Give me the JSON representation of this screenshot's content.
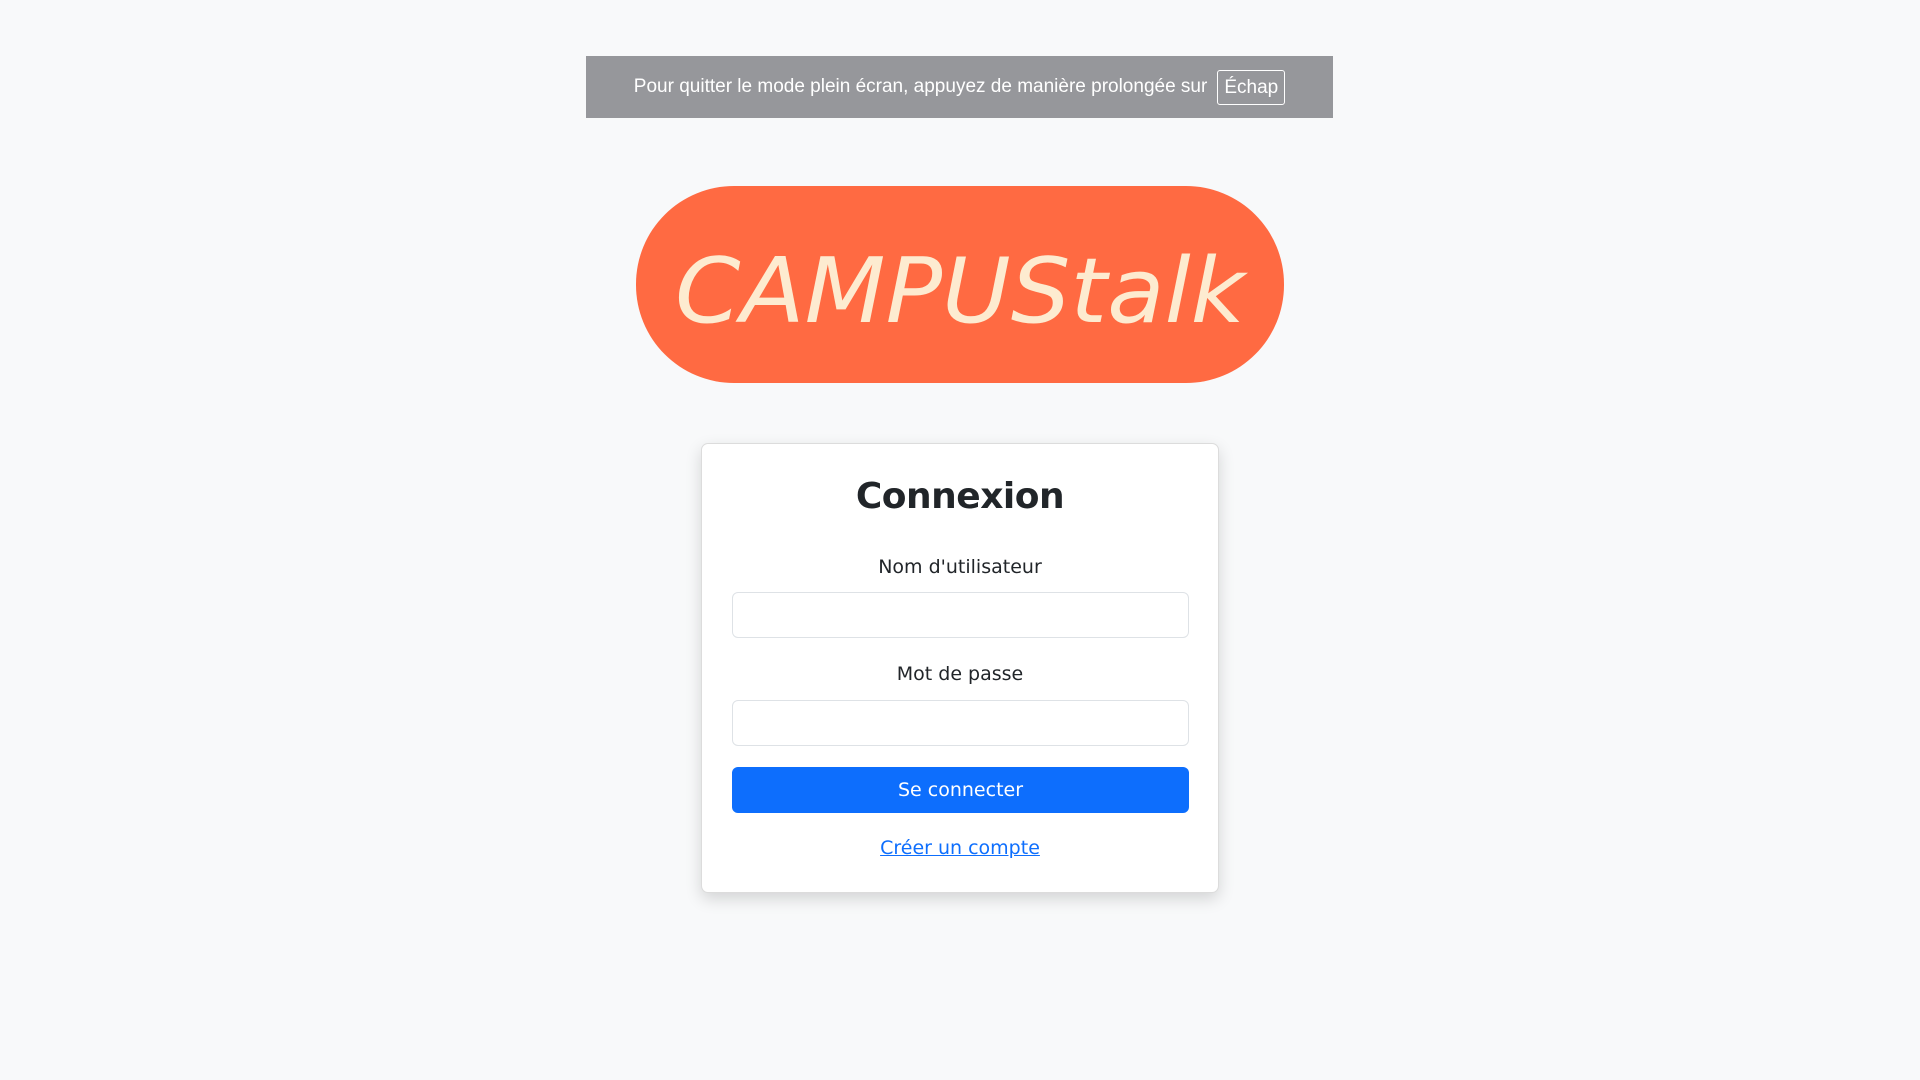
{
  "fullscreen_notice": {
    "text": "Pour quitter le mode plein écran, appuyez de manière prolongée sur",
    "key": "Échap"
  },
  "logo": {
    "text": "CAMPUStalk",
    "background_color": "#ff6a42",
    "text_color": "#fdebd0"
  },
  "login": {
    "title": "Connexion",
    "username_label": "Nom d'utilisateur",
    "username_value": "",
    "password_label": "Mot de passe",
    "password_value": "",
    "submit_label": "Se connecter",
    "create_account_label": "Créer un compte"
  },
  "colors": {
    "page_background": "#f8f9fa",
    "primary": "#0d6efd"
  }
}
